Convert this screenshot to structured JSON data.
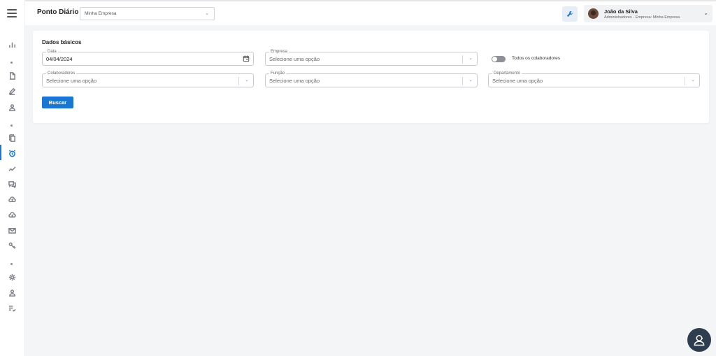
{
  "header": {
    "title": "Ponto Diário",
    "company_select": "Minha Empresa",
    "user": {
      "name": "João da Silva",
      "role": "Administradores - Empresa: Minha Empresa"
    }
  },
  "form": {
    "section_title": "Dados básicos",
    "date": {
      "label": "Data",
      "value": "04/04/2024"
    },
    "empresa": {
      "label": "Empresa",
      "placeholder": "Selecione uma opção"
    },
    "toggle": {
      "label": "Todos os colaboradores",
      "checked": false
    },
    "colaboradores": {
      "label": "Colaboradores",
      "placeholder": "Selecione uma opção"
    },
    "funcao": {
      "label": "Função",
      "placeholder": "Selecione uma opção"
    },
    "departamento": {
      "label": "Departamento",
      "placeholder": "Selecione uma opção"
    },
    "search_button": "Buscar"
  },
  "sidebar": {
    "icons": [
      "chart-icon",
      "document-icon",
      "pen-icon",
      "user-icon",
      "copy-icon",
      "alarm-clock-icon",
      "trend-icon",
      "chat-icon",
      "cloud-upload-icon",
      "cloud-download-icon",
      "mail-icon",
      "key-icon",
      "settings-icon",
      "user-icon",
      "list-check-icon"
    ],
    "active": "alarm-clock-icon"
  },
  "colors": {
    "accent": "#1976d2",
    "fab": "#2f3e4e"
  }
}
